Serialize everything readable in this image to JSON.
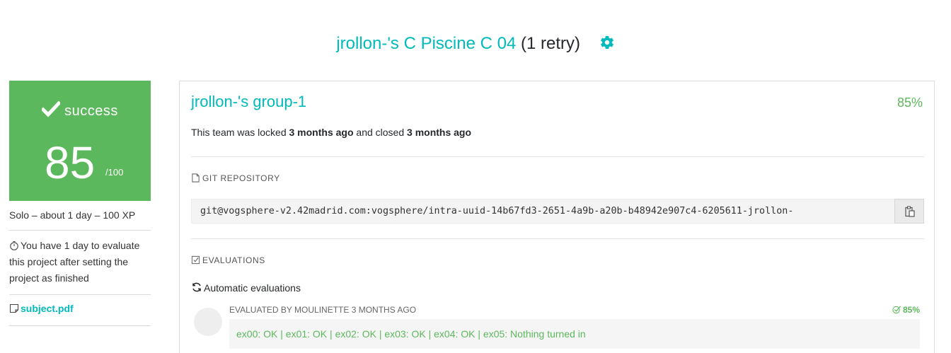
{
  "header": {
    "project_title": "jrollon-'s C Piscine C 04",
    "retry": "(1 retry)",
    "settings_icon": "gear-icon"
  },
  "score": {
    "status": "success",
    "value": "85",
    "max": "/100",
    "status_icon": "check-icon",
    "color": "#5cb85c"
  },
  "sidebar": {
    "info": "Solo – about 1 day – 100 XP",
    "evaluate_note": "You have 1 day to evaluate this project after setting the project as finished",
    "subject_link": "subject.pdf"
  },
  "team": {
    "name": "jrollon-'s group-1",
    "mark": "85%",
    "locked_prefix": "This team was locked",
    "locked_time": "3 months ago",
    "closed_prefix": "and closed",
    "closed_time": "3 months ago"
  },
  "repository": {
    "label": "GIT REPOSITORY",
    "url": "git@vogsphere-v2.42madrid.com:vogsphere/intra-uuid-14b67fd3-2651-4a9b-a20b-b48942e907c4-6205611-jrollon-"
  },
  "evaluations": {
    "label": "EVALUATIONS",
    "automatic_label": "Automatic evaluations",
    "items": [
      {
        "evaluated_by": "EVALUATED BY MOULINETTE 3 MONTHS AGO",
        "mark": "85%",
        "result": "ex00: OK | ex01: OK | ex02: OK | ex03: OK | ex04: OK | ex05: Nothing turned in"
      }
    ]
  },
  "colors": {
    "accent": "#00babc",
    "success": "#5cb85c"
  }
}
